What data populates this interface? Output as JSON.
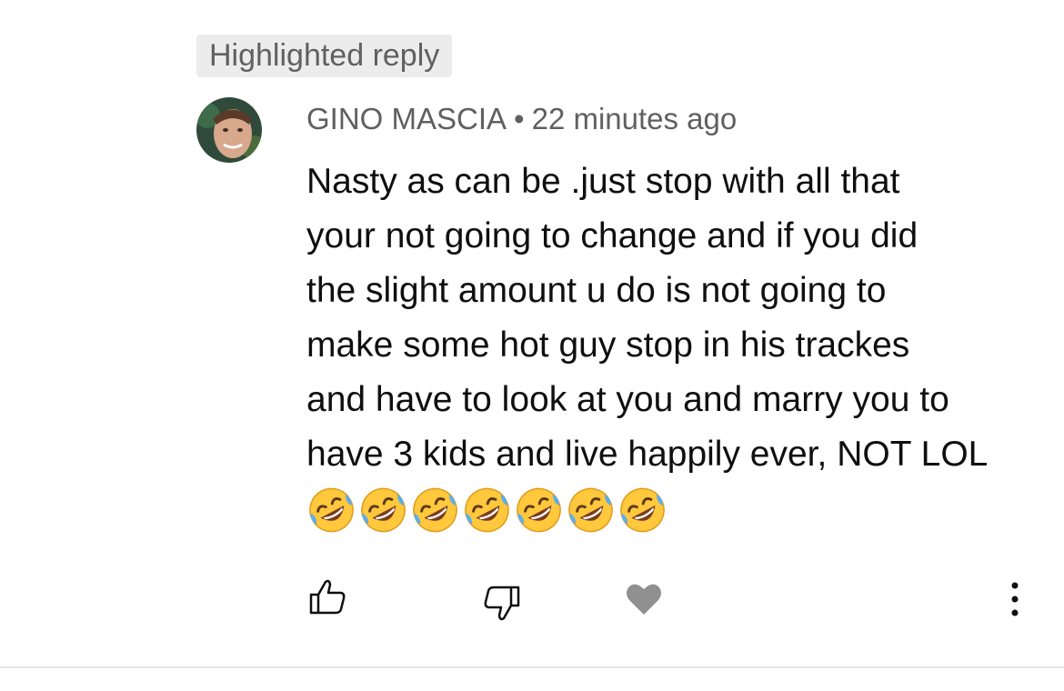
{
  "badge": {
    "label": "Highlighted reply"
  },
  "comment": {
    "author": "GINO MASCIA",
    "separator": "•",
    "time": "22 minutes ago",
    "lines": [
      "Nasty as can be .just stop with all that",
      "your not going to change and if you did",
      "the slight amount u do is not going to",
      "make some hot guy stop in his trackes",
      "and have to look at you and marry you to",
      "have 3 kids and live happily ever, NOT LOL"
    ],
    "emoji_count": 7,
    "emoji_name": "rolling-on-the-floor-laughing"
  },
  "actions": {
    "like_icon": "thumbs-up-icon",
    "dislike_icon": "thumbs-down-icon",
    "heart_icon": "heart-icon",
    "more_icon": "more-vertical-icon"
  },
  "colors": {
    "meta_text": "#606060",
    "badge_bg": "#ececec",
    "heart": "#909090",
    "emoji_face": "#FFC83D"
  }
}
